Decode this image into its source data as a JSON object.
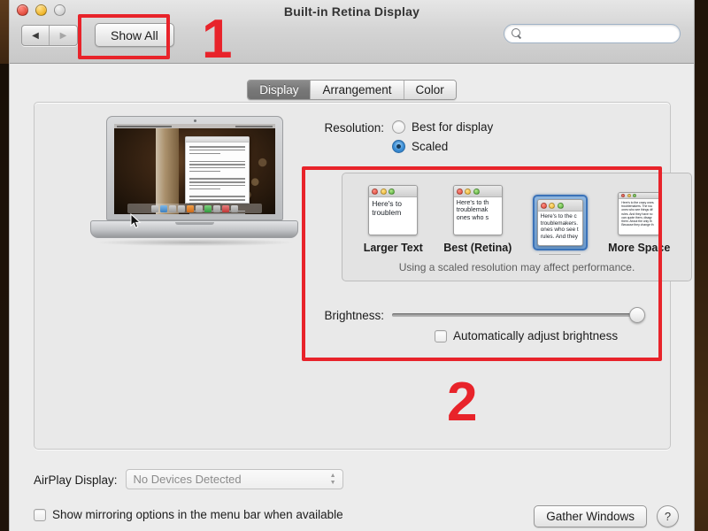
{
  "window": {
    "title": "Built-in Retina Display",
    "traffic_lights": [
      "close",
      "minimize",
      "zoom"
    ],
    "nav": {
      "back": "◀",
      "forward": "▶"
    },
    "show_all_label": "Show All",
    "search": {
      "value": "",
      "placeholder": ""
    }
  },
  "tabs": [
    {
      "label": "Display",
      "active": true
    },
    {
      "label": "Arrangement",
      "active": false
    },
    {
      "label": "Color",
      "active": false
    }
  ],
  "resolution": {
    "label": "Resolution:",
    "options": [
      {
        "label": "Best for display",
        "selected": false
      },
      {
        "label": "Scaled",
        "selected": true
      }
    ],
    "scaled_thumbnails": [
      {
        "label": "Larger Text",
        "selected": false,
        "lines": [
          "Here's to",
          "troublem"
        ]
      },
      {
        "label": "Best (Retina)",
        "selected": false,
        "lines": [
          "Here's to th",
          "troublemak",
          "ones who s"
        ]
      },
      {
        "label": "",
        "selected": true,
        "lines": [
          "Here's to the c",
          "troublemakers.",
          "ones who see t",
          "rules. And they"
        ]
      },
      {
        "label": "More Space",
        "selected": false,
        "lines": [
          "Here's to the crazy ones.",
          "troublemakers. The rou",
          "ones who see things dif",
          "rules. And they have no",
          "can quote them, disagr",
          "them. About the only th",
          "Because they change th"
        ]
      }
    ],
    "hint": "Using a scaled resolution may affect performance."
  },
  "brightness": {
    "label": "Brightness:",
    "value": 100,
    "auto_adjust": {
      "label": "Automatically adjust brightness",
      "checked": false
    }
  },
  "airplay": {
    "label": "AirPlay Display:",
    "selected_value": "No Devices Detected",
    "options": [
      "No Devices Detected"
    ]
  },
  "footer": {
    "mirroring": {
      "label": "Show mirroring options in the menu bar when available",
      "checked": false
    },
    "gather_windows_label": "Gather Windows",
    "help_label": "?"
  },
  "annotations": {
    "marker_one": "1",
    "marker_two": "2",
    "color": "#e8232a"
  },
  "preview": {
    "doc_window_lines": 22
  }
}
